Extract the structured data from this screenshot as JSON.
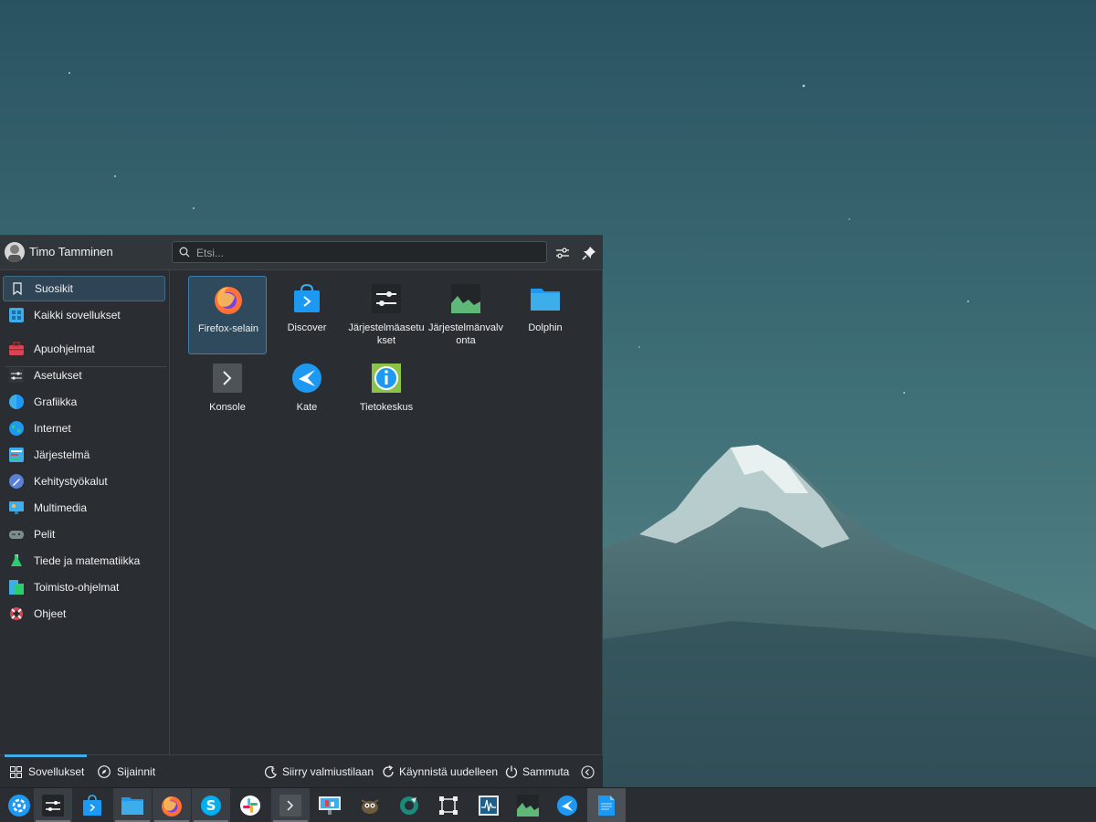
{
  "launcher": {
    "user_name": "Timo Tamminen",
    "search": {
      "placeholder": "Etsi..."
    },
    "categories": [
      {
        "label": "Suosikit",
        "icon": "bookmark-icon",
        "active": true
      },
      {
        "label": "Kaikki sovellukset",
        "icon": "grid-apps-icon"
      },
      {
        "label": "Apuohjelmat",
        "icon": "toolbox-icon"
      },
      {
        "label": "Asetukset",
        "icon": "settings-sliders-icon"
      },
      {
        "label": "Grafiikka",
        "icon": "graphics-icon"
      },
      {
        "label": "Internet",
        "icon": "globe-icon"
      },
      {
        "label": "Järjestelmä",
        "icon": "system-icon"
      },
      {
        "label": "Kehitystyökalut",
        "icon": "development-icon"
      },
      {
        "label": "Multimedia",
        "icon": "multimedia-icon"
      },
      {
        "label": "Pelit",
        "icon": "gamepad-icon"
      },
      {
        "label": "Tiede ja matematiikka",
        "icon": "science-icon"
      },
      {
        "label": "Toimisto-ohjelmat",
        "icon": "office-icon"
      },
      {
        "label": "Ohjeet",
        "icon": "help-lifebuoy-icon"
      }
    ],
    "apps": [
      {
        "label": "Firefox-selain",
        "icon": "firefox-icon",
        "active": true
      },
      {
        "label": "Discover",
        "icon": "discover-icon"
      },
      {
        "label": "Järjestelmäasetukset",
        "icon": "system-settings-icon"
      },
      {
        "label": "Järjestelmänvalvonta",
        "icon": "system-monitor-icon"
      },
      {
        "label": "Dolphin",
        "icon": "folder-icon"
      },
      {
        "label": "Konsole",
        "icon": "terminal-icon"
      },
      {
        "label": "Kate",
        "icon": "kate-icon"
      },
      {
        "label": "Tietokeskus",
        "icon": "info-center-icon"
      }
    ],
    "footer": {
      "tab_apps": "Sovellukset",
      "tab_places": "Sijainnit",
      "sleep": "Siirry valmiustilaan",
      "restart": "Käynnistä uudelleen",
      "shutdown": "Sammuta"
    }
  },
  "taskbar": {
    "items": [
      "kde-launcher-icon",
      "system-settings-icon",
      "discover-icon",
      "folder-icon",
      "firefox-icon",
      "skype-icon",
      "slack-icon",
      "terminal-icon",
      "presentation-icon",
      "gimp-icon",
      "krita-icon",
      "transform-icon",
      "system-monitor-icon",
      "system-monitor-graph-icon",
      "kate-icon",
      "document-icon"
    ]
  },
  "colors": {
    "accent": "#3daee9",
    "panel": "#2a2e32",
    "header": "#31363b"
  }
}
